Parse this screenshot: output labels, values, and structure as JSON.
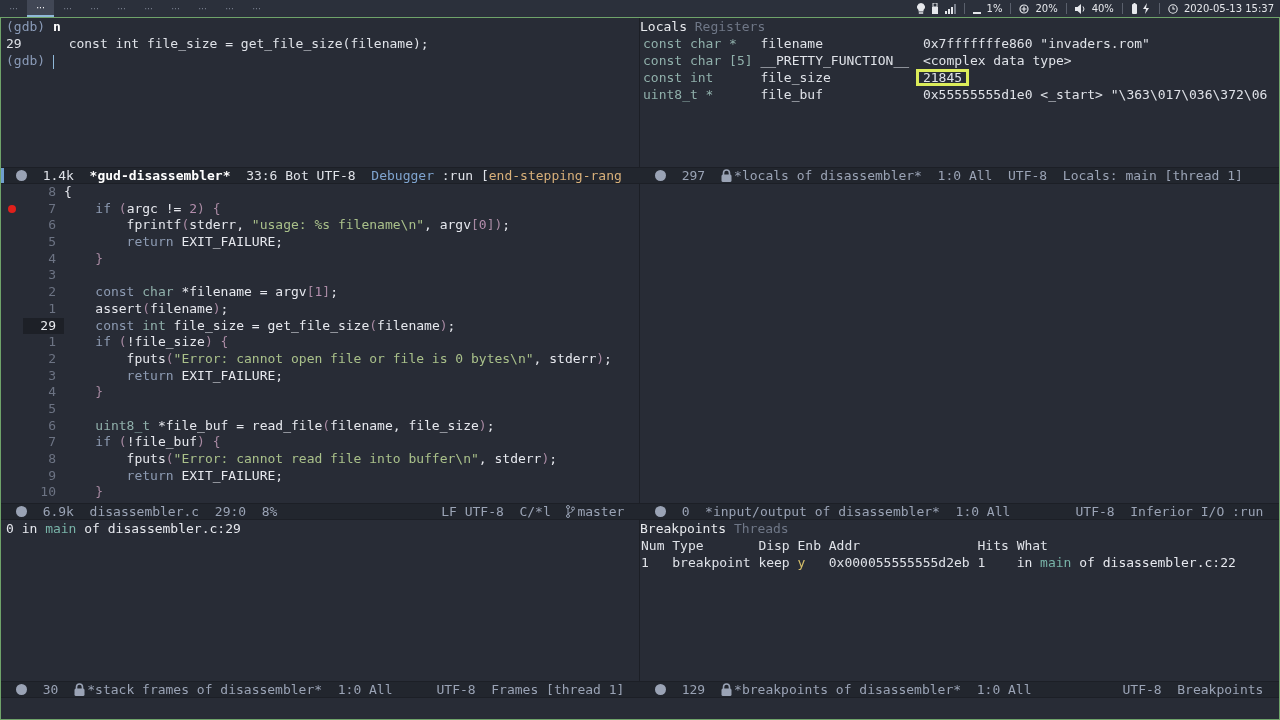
{
  "topbar": {
    "workspaces": [
      {
        "label": "···",
        "selected": false
      },
      {
        "label": "···",
        "selected": true
      },
      {
        "label": "···",
        "selected": false
      },
      {
        "label": "···",
        "selected": false
      },
      {
        "label": "···",
        "selected": false
      },
      {
        "label": "···",
        "selected": false
      },
      {
        "label": "···",
        "selected": false
      },
      {
        "label": "···",
        "selected": false
      },
      {
        "label": "···",
        "selected": false
      },
      {
        "label": "···",
        "selected": false
      }
    ],
    "tray": [
      [
        {
          "kind": "bulb"
        },
        {
          "kind": "device"
        },
        {
          "kind": "signal"
        }
      ],
      [
        {
          "kind": "disk",
          "text": "1%"
        }
      ],
      [
        {
          "kind": "cpu",
          "text": "20%"
        }
      ],
      [
        {
          "kind": "volume",
          "text": "40%"
        }
      ],
      [
        {
          "kind": "battery"
        }
      ],
      [
        {
          "kind": "clock",
          "text": "2020-05-13 15:37"
        }
      ]
    ]
  },
  "gdb": {
    "lines": [
      {
        "kind": "prompt",
        "prompt": "(gdb)",
        "input": "n",
        "cursor": false
      },
      {
        "kind": "output",
        "text": "29\tconst int file_size = get_file_size(filename);"
      },
      {
        "kind": "prompt",
        "prompt": "(gdb)",
        "cursor": true
      }
    ],
    "modeline": {
      "active": true,
      "left": [
        {
          "kind": "text",
          "text": "1.4k"
        },
        {
          "kind": "text",
          "text": "*gud-disassembler*",
          "bold": true
        },
        {
          "kind": "text",
          "text": "33:6 Bot UTF-8"
        },
        {
          "kind": "mode",
          "parts": [
            {
              "kind": "mode",
              "text": "Debugger"
            },
            {
              "kind": "plain",
              "text": ":run ["
            },
            {
              "kind": "state",
              "text": "end-stepping-rang"
            }
          ]
        }
      ]
    }
  },
  "locals": {
    "tabs": [
      {
        "label": "Locals",
        "selected": true
      },
      {
        "label": "Registers",
        "selected": false
      }
    ],
    "rows": [
      {
        "type": "const char *",
        "name": "filename",
        "value": "0x7fffffffe860 \"invaders.rom\"",
        "highlighted": false
      },
      {
        "type": "const char [5]",
        "name": "__PRETTY_FUNCTION__",
        "value": "<complex data type>",
        "highlighted": false
      },
      {
        "type": "const int",
        "name": "file_size",
        "value": "21845",
        "highlighted": true
      },
      {
        "type": "uint8_t *",
        "name": "file_buf",
        "value": "0x55555555d1e0 <_start> \"\\363\\017\\036\\372\\06",
        "highlighted": false
      }
    ],
    "modeline": {
      "active": false,
      "left": [
        {
          "kind": "text",
          "text": "297"
        },
        {
          "kind": "lock"
        },
        {
          "kind": "text",
          "text": "*locals of disassembler*"
        },
        {
          "kind": "text",
          "text": "1:0 All"
        },
        {
          "kind": "text",
          "text": "UTF-8"
        },
        {
          "kind": "text",
          "text": "Locals: main [thread 1]"
        }
      ]
    }
  },
  "source": {
    "lines": [
      {
        "num": "8",
        "breakpoint": false,
        "current": false,
        "tokens": [
          {
            "kind": "p",
            "text": "{"
          }
        ]
      },
      {
        "num": "7",
        "breakpoint": true,
        "current": false,
        "tokens": [
          {
            "kind": "kw",
            "text": "    if "
          },
          {
            "kind": "punc",
            "text": "("
          },
          {
            "kind": "p",
            "text": "argc != "
          },
          {
            "kind": "num",
            "text": "2"
          },
          {
            "kind": "punc",
            "text": ") {"
          }
        ]
      },
      {
        "num": "6",
        "breakpoint": false,
        "current": false,
        "tokens": [
          {
            "kind": "p",
            "text": "        fprintf"
          },
          {
            "kind": "punc",
            "text": "("
          },
          {
            "kind": "p",
            "text": "stderr, "
          },
          {
            "kind": "str",
            "text": "\"usage: %s filename\\n\""
          },
          {
            "kind": "p",
            "text": ", argv"
          },
          {
            "kind": "punc",
            "text": "["
          },
          {
            "kind": "num",
            "text": "0"
          },
          {
            "kind": "punc",
            "text": "])"
          },
          {
            "kind": "p",
            "text": ";"
          }
        ]
      },
      {
        "num": "5",
        "breakpoint": false,
        "current": false,
        "tokens": [
          {
            "kind": "kw",
            "text": "        return"
          },
          {
            "kind": "p",
            "text": " EXIT_FAILURE;"
          }
        ]
      },
      {
        "num": "4",
        "breakpoint": false,
        "current": false,
        "tokens": [
          {
            "kind": "punc",
            "text": "    }"
          }
        ]
      },
      {
        "num": "3",
        "breakpoint": false,
        "current": false
      },
      {
        "num": "2",
        "breakpoint": false,
        "current": false,
        "tokens": [
          {
            "kind": "kw",
            "text": "    const "
          },
          {
            "kind": "type",
            "text": "char"
          },
          {
            "kind": "p",
            "text": " *filename = argv"
          },
          {
            "kind": "punc",
            "text": "["
          },
          {
            "kind": "num",
            "text": "1"
          },
          {
            "kind": "punc",
            "text": "]"
          },
          {
            "kind": "p",
            "text": ";"
          }
        ]
      },
      {
        "num": "1",
        "breakpoint": false,
        "current": false,
        "tokens": [
          {
            "kind": "p",
            "text": "    assert"
          },
          {
            "kind": "punc",
            "text": "("
          },
          {
            "kind": "p",
            "text": "filename"
          },
          {
            "kind": "punc",
            "text": ")"
          },
          {
            "kind": "p",
            "text": ";"
          }
        ]
      },
      {
        "num": "29",
        "breakpoint": false,
        "current": true,
        "tokens": [
          {
            "kind": "kw",
            "text": "    const "
          },
          {
            "kind": "type",
            "text": "int"
          },
          {
            "kind": "p",
            "text": " file_size = get_file_size"
          },
          {
            "kind": "punc",
            "text": "("
          },
          {
            "kind": "p",
            "text": "filename"
          },
          {
            "kind": "punc",
            "text": ")"
          },
          {
            "kind": "p",
            "text": ";"
          }
        ]
      },
      {
        "num": "1",
        "breakpoint": false,
        "current": false,
        "tokens": [
          {
            "kind": "kw",
            "text": "    if "
          },
          {
            "kind": "punc",
            "text": "("
          },
          {
            "kind": "p",
            "text": "!file_size"
          },
          {
            "kind": "punc",
            "text": ") {"
          }
        ]
      },
      {
        "num": "2",
        "breakpoint": false,
        "current": false,
        "tokens": [
          {
            "kind": "p",
            "text": "        fputs"
          },
          {
            "kind": "punc",
            "text": "("
          },
          {
            "kind": "str",
            "text": "\"Error: cannot open file or file is 0 bytes\\n\""
          },
          {
            "kind": "p",
            "text": ", stderr"
          },
          {
            "kind": "punc",
            "text": ")"
          },
          {
            "kind": "p",
            "text": ";"
          }
        ]
      },
      {
        "num": "3",
        "breakpoint": false,
        "current": false,
        "tokens": [
          {
            "kind": "kw",
            "text": "        return"
          },
          {
            "kind": "p",
            "text": " EXIT_FAILURE;"
          }
        ]
      },
      {
        "num": "4",
        "breakpoint": false,
        "current": false,
        "tokens": [
          {
            "kind": "punc",
            "text": "    }"
          }
        ]
      },
      {
        "num": "5",
        "breakpoint": false,
        "current": false
      },
      {
        "num": "6",
        "breakpoint": false,
        "current": false,
        "tokens": [
          {
            "kind": "type",
            "text": "    uint8_t"
          },
          {
            "kind": "p",
            "text": " *file_buf = read_file"
          },
          {
            "kind": "punc",
            "text": "("
          },
          {
            "kind": "p",
            "text": "filename, file_size"
          },
          {
            "kind": "punc",
            "text": ")"
          },
          {
            "kind": "p",
            "text": ";"
          }
        ]
      },
      {
        "num": "7",
        "breakpoint": false,
        "current": false,
        "tokens": [
          {
            "kind": "kw",
            "text": "    if "
          },
          {
            "kind": "punc",
            "text": "("
          },
          {
            "kind": "p",
            "text": "!file_buf"
          },
          {
            "kind": "punc",
            "text": ") {"
          }
        ]
      },
      {
        "num": "8",
        "breakpoint": false,
        "current": false,
        "tokens": [
          {
            "kind": "p",
            "text": "        fputs"
          },
          {
            "kind": "punc",
            "text": "("
          },
          {
            "kind": "str",
            "text": "\"Error: cannot read file into buffer\\n\""
          },
          {
            "kind": "p",
            "text": ", stderr"
          },
          {
            "kind": "punc",
            "text": ")"
          },
          {
            "kind": "p",
            "text": ";"
          }
        ]
      },
      {
        "num": "9",
        "breakpoint": false,
        "current": false,
        "tokens": [
          {
            "kind": "kw",
            "text": "        return"
          },
          {
            "kind": "p",
            "text": " EXIT_FAILURE;"
          }
        ]
      },
      {
        "num": "10",
        "breakpoint": false,
        "current": false,
        "tokens": [
          {
            "kind": "punc",
            "text": "    }"
          }
        ]
      }
    ],
    "modeline": {
      "active": false,
      "left": [
        {
          "kind": "text",
          "text": "6.9k"
        },
        {
          "kind": "text",
          "text": "disassembler.c"
        },
        {
          "kind": "text",
          "text": "29:0"
        },
        {
          "kind": "text",
          "text": "8%"
        }
      ],
      "right": [
        {
          "kind": "text",
          "text": "LF UTF-8"
        },
        {
          "kind": "text",
          "text": "C/*l"
        },
        {
          "kind": "branch",
          "text": "master"
        }
      ]
    }
  },
  "io": {
    "modeline": {
      "active": false,
      "left": [
        {
          "kind": "text",
          "text": "0"
        },
        {
          "kind": "text",
          "text": "*input/output of disassembler*"
        },
        {
          "kind": "text",
          "text": "1:0 All"
        }
      ],
      "right": [
        {
          "kind": "text",
          "text": "UTF-8"
        },
        {
          "kind": "text",
          "text": "Inferior I/O :run"
        }
      ]
    }
  },
  "stack": {
    "frames": [
      {
        "tokens": [
          {
            "kind": "p",
            "text": "0 in "
          },
          {
            "kind": "fn",
            "text": "main"
          },
          {
            "kind": "p",
            "text": " of disassembler.c:29"
          }
        ]
      }
    ],
    "modeline": {
      "active": false,
      "left": [
        {
          "kind": "text",
          "text": "30"
        },
        {
          "kind": "lock"
        },
        {
          "kind": "text",
          "text": "*stack frames of disassembler*"
        },
        {
          "kind": "text",
          "text": "1:0 All"
        }
      ],
      "right": [
        {
          "kind": "text",
          "text": "UTF-8"
        },
        {
          "kind": "text",
          "text": "Frames [thread 1]"
        }
      ]
    }
  },
  "breakpoints": {
    "tabs": [
      {
        "label": "Breakpoints",
        "selected": true
      },
      {
        "label": "Threads",
        "selected": false
      }
    ],
    "columns": [
      "Num",
      "Type",
      "Disp",
      "Enb",
      "Addr",
      "Hits",
      "What"
    ],
    "rows": [
      {
        "num": "1",
        "type": "breakpoint",
        "disp": "keep",
        "enb": "y",
        "enabled": true,
        "addr": "0x000055555555d2eb",
        "hits": "1",
        "what": [
          {
            "kind": "p",
            "text": "in "
          },
          {
            "kind": "fn",
            "text": "main"
          },
          {
            "kind": "p",
            "text": " of disassembler.c:22"
          }
        ]
      }
    ],
    "modeline": {
      "active": false,
      "left": [
        {
          "kind": "text",
          "text": "129"
        },
        {
          "kind": "lock"
        },
        {
          "kind": "text",
          "text": "*breakpoints of disassembler*"
        },
        {
          "kind": "text",
          "text": "1:0 All"
        }
      ],
      "right": [
        {
          "kind": "text",
          "text": "UTF-8"
        },
        {
          "kind": "text",
          "text": "Breakpoints"
        }
      ]
    }
  }
}
